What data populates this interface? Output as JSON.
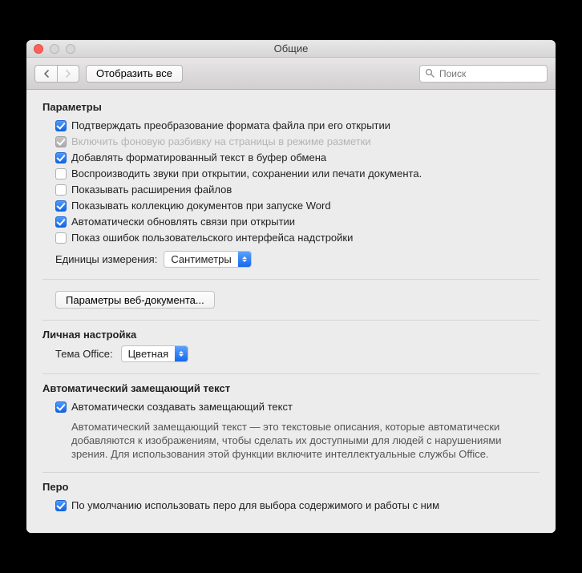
{
  "window": {
    "title": "Общие"
  },
  "toolbar": {
    "show_all": "Отобразить все",
    "search_placeholder": "Поиск"
  },
  "sections": {
    "params": {
      "title": "Параметры",
      "options": [
        {
          "label": "Подтверждать преобразование формата файла при его открытии",
          "checked": true,
          "disabled": false
        },
        {
          "label": "Включить фоновую разбивку на страницы в режиме разметки",
          "checked": true,
          "disabled": true
        },
        {
          "label": "Добавлять форматированный текст в буфер обмена",
          "checked": true,
          "disabled": false
        },
        {
          "label": "Воспроизводить звуки при открытии, сохранении или печати документа.",
          "checked": false,
          "disabled": false
        },
        {
          "label": "Показывать расширения файлов",
          "checked": false,
          "disabled": false
        },
        {
          "label": "Показывать коллекцию документов при запуске Word",
          "checked": true,
          "disabled": false
        },
        {
          "label": "Автоматически обновлять связи при открытии",
          "checked": true,
          "disabled": false
        },
        {
          "label": "Показ ошибок пользовательского интерфейса надстройки",
          "checked": false,
          "disabled": false
        }
      ],
      "units_label": "Единицы измерения:",
      "units_value": "Сантиметры",
      "web_button": "Параметры веб-документа..."
    },
    "personal": {
      "title": "Личная настройка",
      "theme_label": "Тема Office:",
      "theme_value": "Цветная"
    },
    "alttext": {
      "title": "Автоматический замещающий текст",
      "option_label": "Автоматически создавать замещающий текст",
      "option_checked": true,
      "description": "Автоматический замещающий текст — это текстовые описания, которые автоматически добавляются к изображениям, чтобы сделать их доступными для людей с нарушениями зрения. Для использования этой функции включите интеллектуальные службы Office."
    },
    "pen": {
      "title": "Перо",
      "option_label": "По умолчанию использовать перо для выбора содержимого и работы с ним",
      "option_checked": true
    }
  }
}
